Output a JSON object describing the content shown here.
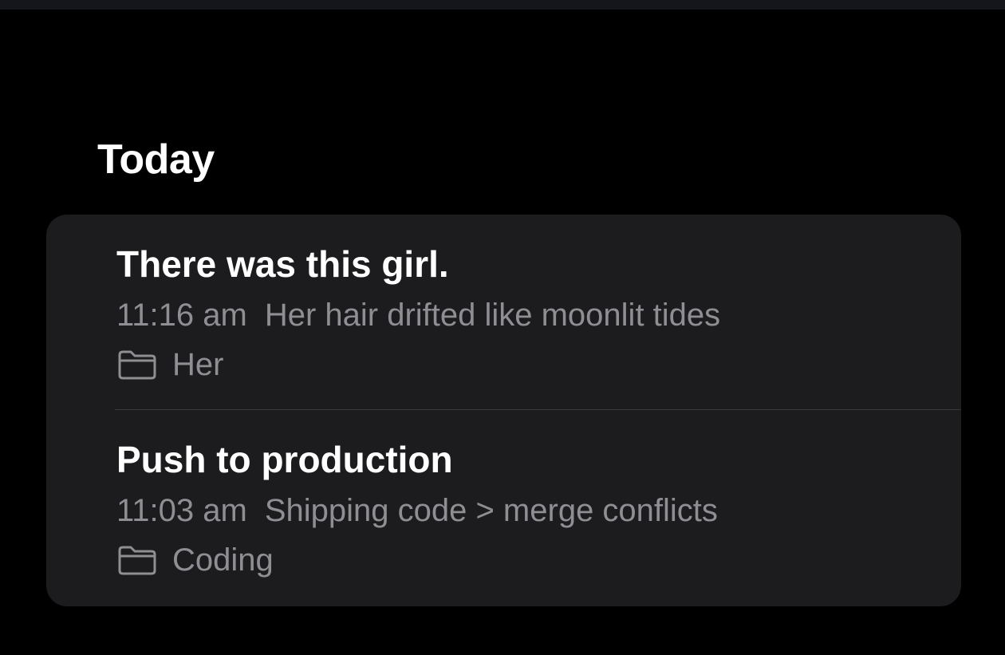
{
  "section": {
    "title": "Today"
  },
  "notes": [
    {
      "title": "There was this girl.",
      "time": "11:16 am",
      "preview": "Her hair drifted like moonlit tides",
      "folder": "Her",
      "folder_icon": "folder-icon"
    },
    {
      "title": "Push to production",
      "time": "11:03 am",
      "preview": "Shipping code > merge conflicts",
      "folder": "Coding",
      "folder_icon": "folder-icon"
    }
  ],
  "colors": {
    "background": "#000000",
    "card": "#1c1c1e",
    "primary_text": "#ffffff",
    "secondary_text": "#8e8e93",
    "divider": "#38383a"
  }
}
